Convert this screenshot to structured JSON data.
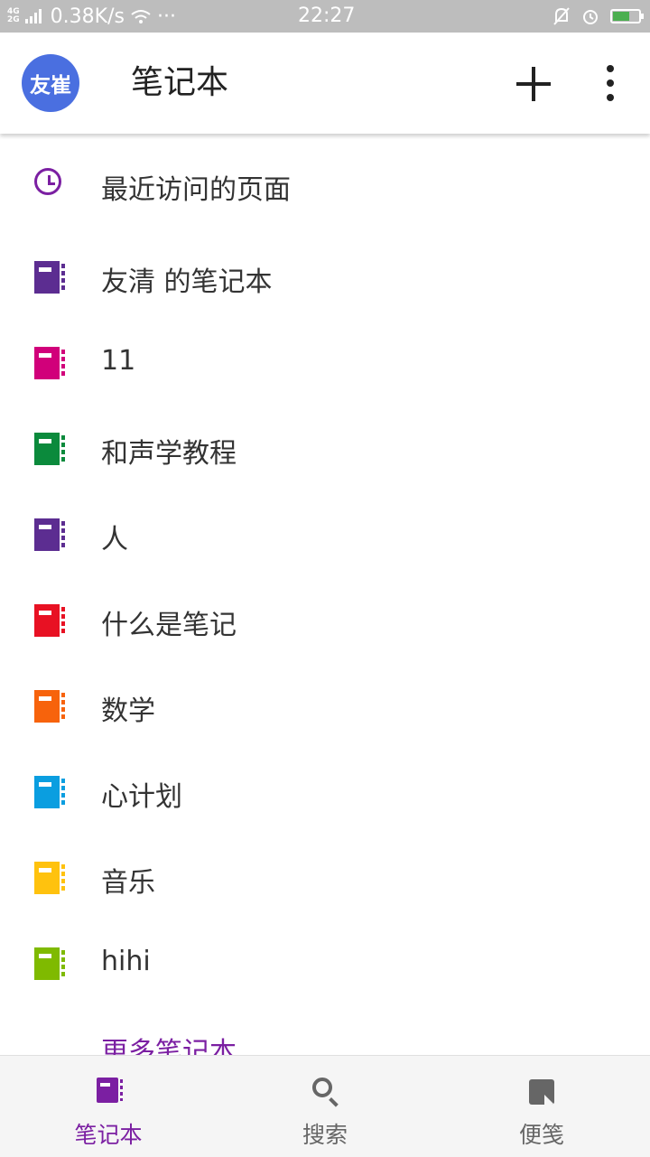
{
  "status_bar": {
    "network": [
      "4G",
      "2G"
    ],
    "speed": "0.38K/s",
    "dots": "···",
    "time": "22:27"
  },
  "header": {
    "avatar_text": "友崔",
    "title": "笔记本"
  },
  "recent": {
    "label": "最近访问的页面"
  },
  "notebooks": [
    {
      "label": "友清 的笔记本",
      "color": "#5c2d91"
    },
    {
      "label": "11",
      "color": "#d1007a"
    },
    {
      "label": "和声学教程",
      "color": "#0b8a3c"
    },
    {
      "label": "人",
      "color": "#5c2d91"
    },
    {
      "label": "什么是笔记",
      "color": "#e81123"
    },
    {
      "label": "数学",
      "color": "#f7630c"
    },
    {
      "label": "心计划",
      "color": "#0a9ee0"
    },
    {
      "label": "音乐",
      "color": "#ffc20e"
    },
    {
      "label": "hihi",
      "color": "#7fba00"
    }
  ],
  "more_notebooks": "更多笔记本",
  "bottom_nav": [
    {
      "label": "笔记本",
      "icon": "notebook-icon",
      "active": true
    },
    {
      "label": "搜索",
      "icon": "search-icon",
      "active": false
    },
    {
      "label": "便笺",
      "icon": "sticky-note-icon",
      "active": false
    }
  ],
  "colors": {
    "accent": "#7b1fa2",
    "avatar": "#4a6fe0"
  }
}
